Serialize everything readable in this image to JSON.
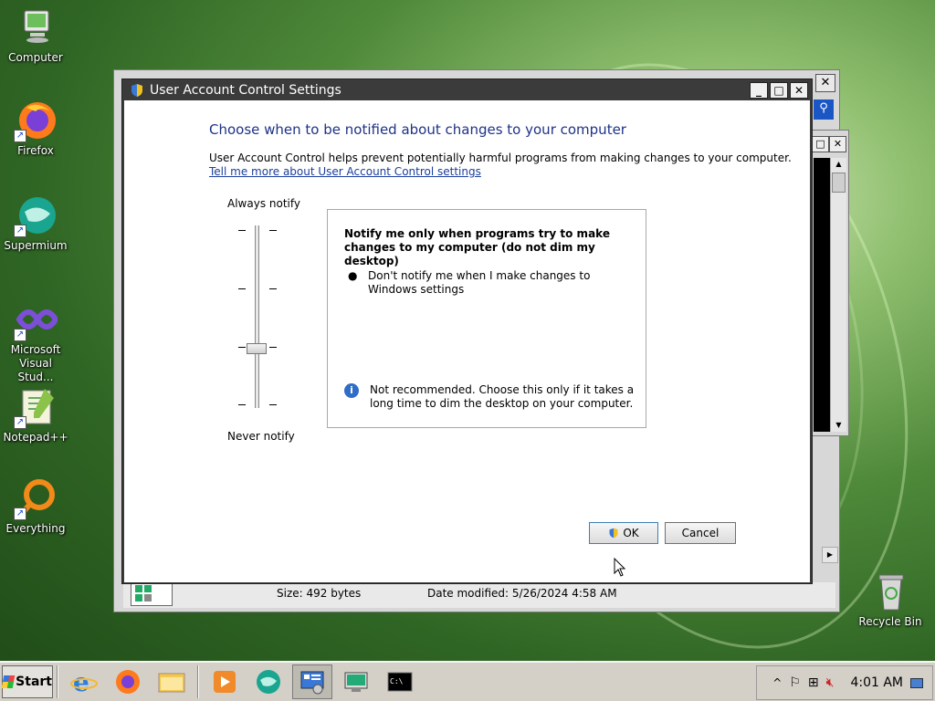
{
  "desktop": {
    "icons": [
      {
        "label": "Computer",
        "icon": "computer-icon"
      },
      {
        "label": "Firefox",
        "icon": "firefox-icon"
      },
      {
        "label": "Supermium",
        "icon": "supermium-icon"
      },
      {
        "label": "Microsoft Visual Stud...",
        "icon": "visual-studio-icon"
      },
      {
        "label": "Notepad++",
        "icon": "notepadpp-icon"
      },
      {
        "label": "Everything",
        "icon": "everything-icon"
      },
      {
        "label": "Recycle Bin",
        "icon": "recycle-bin-icon"
      }
    ]
  },
  "dialog": {
    "title": "User Account Control Settings",
    "heading": "Choose when to be notified about changes to your computer",
    "description": "User Account Control helps prevent potentially harmful programs from making changes to your computer.",
    "link": "Tell me more about User Account Control settings",
    "slider_top_label": "Always notify",
    "slider_bottom_label": "Never notify",
    "slider_level": 3,
    "slider_levels_total": 4,
    "info_title": "Notify me only when programs try to make changes to my computer (do not dim my desktop)",
    "info_bullet": "Don't notify me when I make changes to Windows settings",
    "info_note": "Not recommended. Choose this only if it takes a long time to dim the desktop on your computer.",
    "ok_label": "OK",
    "cancel_label": "Cancel"
  },
  "background_window": {
    "size_text": "Size: 492 bytes",
    "date_text": "Date modified: 5/26/2024 4:58 AM"
  },
  "taskbar": {
    "start_label": "Start",
    "apps": [
      "ie-icon",
      "firefox-icon",
      "explorer-icon",
      "media-player-icon",
      "supermium-icon",
      "control-panel-icon",
      "remote-desktop-icon",
      "cmd-icon"
    ],
    "clock": "4:01 AM"
  },
  "colors": {
    "titlebar": "#3b3b3b",
    "heading": "#1e3287",
    "link": "#1a3e9b",
    "taskbar": "#d4d0c8"
  }
}
